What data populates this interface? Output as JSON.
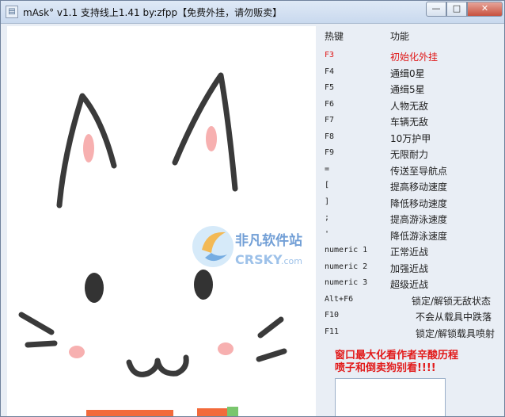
{
  "window": {
    "title": "mAsk° v1.1 支持线上1.41 by:zfpp【免费外挂，请勿贩卖】",
    "min_glyph": "—",
    "max_glyph": "□",
    "close_glyph": "✕"
  },
  "panel": {
    "col_hotkey": "热键",
    "col_function": "功能",
    "rows": [
      {
        "key": "F3",
        "func": "初始化外挂",
        "highlight": true
      },
      {
        "key": "F4",
        "func": "通缉0星"
      },
      {
        "key": "F5",
        "func": "通缉5星"
      },
      {
        "key": "F6",
        "func": "人物无敌"
      },
      {
        "key": "F7",
        "func": "车辆无敌"
      },
      {
        "key": "F8",
        "func": "10万护甲"
      },
      {
        "key": "F9",
        "func": "无限耐力"
      },
      {
        "key": "=",
        "func": "传送至导航点"
      },
      {
        "key": "[",
        "func": "提高移动速度"
      },
      {
        "key": "]",
        "func": "降低移动速度"
      },
      {
        "key": ";",
        "func": "提高游泳速度"
      },
      {
        "key": "'",
        "func": "降低游泳速度"
      },
      {
        "key": "numeric 1",
        "func": "正常近战"
      },
      {
        "key": "numeric 2",
        "func": "加强近战"
      },
      {
        "key": "numeric 3",
        "func": "超级近战"
      },
      {
        "key": "Alt+F6",
        "func": "锁定/解锁无敌状态"
      },
      {
        "key": "F10",
        "func": "不会从载具中跌落"
      },
      {
        "key": "F11",
        "func": "锁定/解锁载具喷射"
      }
    ],
    "note_line1": "窗口最大化看作者辛酸历程",
    "note_line2": "喷子和倒卖狗别看!!!!"
  },
  "watermark": {
    "cn": "非凡软件站",
    "en": "CRSKY",
    "suffix": ".com"
  },
  "colors": {
    "highlight": "#e01818",
    "note": "#e21a1a",
    "drawing_stroke": "#3a3a3a",
    "blush": "#f7b0b0"
  }
}
